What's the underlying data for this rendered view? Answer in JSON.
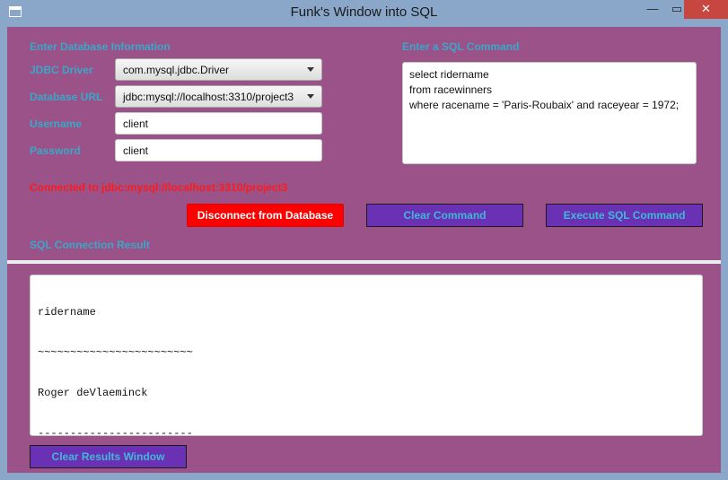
{
  "window": {
    "title": "Funk's Window into SQL",
    "minimize_glyph": "—",
    "maximize_glyph": "▭",
    "close_glyph": "✕"
  },
  "db_info": {
    "heading": "Enter Database Information",
    "driver_label": "JDBC Driver",
    "driver_value": "com.mysql.jdbc.Driver",
    "url_label": "Database URL",
    "url_value": "jdbc:mysql://localhost:3310/project3",
    "username_label": "Username",
    "username_value": "client",
    "password_label": "Password",
    "password_value": "client"
  },
  "sql_command": {
    "heading": "Enter a SQL Command",
    "lines": [
      "select ridername",
      "from racewinners",
      "where racename = 'Paris-Roubaix' and raceyear = 1972;"
    ]
  },
  "status": {
    "text": "Connected to jdbc:mysql://localhost:3310/project3"
  },
  "buttons": {
    "disconnect": "Disconnect from Database",
    "clear_command": "Clear Command",
    "execute": "Execute SQL Command",
    "clear_results": "Clear Results Window"
  },
  "results": {
    "heading": "SQL Connection Result",
    "lines": [
      "ridername",
      "~~~~~~~~~~~~~~~~~~~~~~~~",
      "Roger deVlaeminck",
      "------------------------"
    ]
  },
  "colors": {
    "window_chrome": "#8aa6c9",
    "panel_bg": "#9b5289",
    "label_text": "#3aa7c7",
    "status_text": "#ff1a1a",
    "disconnect_bg": "#ff0000",
    "button_bg": "#6a31b4",
    "close_button": "#c7463f"
  }
}
